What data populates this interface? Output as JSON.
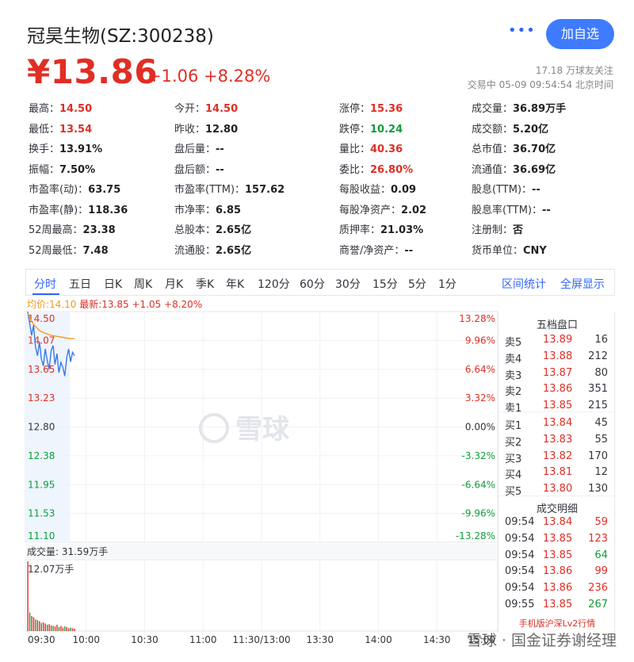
{
  "header": {
    "title": "冠昊生物(SZ:300238)",
    "more_icon": "more-dots-icon",
    "follow_label": "加自选",
    "price": "¥13.86",
    "change": "+1.06 +8.28%",
    "fans": "17.18 万球友关注",
    "status": "交易中 05-09 09:54:54 北京时间"
  },
  "quote": {
    "rows": [
      [
        {
          "label": "最高：",
          "value": "14.50",
          "color": "red"
        },
        {
          "label": "今开：",
          "value": "14.50",
          "color": "red"
        },
        {
          "label": "涨停：",
          "value": "15.36",
          "color": "red"
        },
        {
          "label": "成交量：",
          "value": "36.89万手",
          "color": ""
        }
      ],
      [
        {
          "label": "最低：",
          "value": "13.54",
          "color": "red"
        },
        {
          "label": "昨收：",
          "value": "12.80",
          "color": ""
        },
        {
          "label": "跌停：",
          "value": "10.24",
          "color": "green"
        },
        {
          "label": "成交额：",
          "value": "5.20亿",
          "color": ""
        }
      ],
      [
        {
          "label": "换手：",
          "value": "13.91%",
          "color": ""
        },
        {
          "label": "盘后量：",
          "value": "--",
          "color": ""
        },
        {
          "label": "量比：",
          "value": "40.36",
          "color": "red"
        },
        {
          "label": "总市值：",
          "value": "36.70亿",
          "color": ""
        }
      ],
      [
        {
          "label": "振幅：",
          "value": "7.50%",
          "color": ""
        },
        {
          "label": "盘后额：",
          "value": "--",
          "color": ""
        },
        {
          "label": "委比：",
          "value": "26.80%",
          "color": "red"
        },
        {
          "label": "流通值：",
          "value": "36.69亿",
          "color": ""
        }
      ],
      [
        {
          "label": "市盈率(动)：",
          "value": "63.75",
          "color": ""
        },
        {
          "label": "市盈率(TTM)：",
          "value": "157.62",
          "color": ""
        },
        {
          "label": "每股收益：",
          "value": "0.09",
          "color": ""
        },
        {
          "label": "股息(TTM)：",
          "value": "--",
          "color": ""
        }
      ],
      [
        {
          "label": "市盈率(静)：",
          "value": "118.36",
          "color": ""
        },
        {
          "label": "市净率：",
          "value": "6.85",
          "color": ""
        },
        {
          "label": "每股净资产：",
          "value": "2.02",
          "color": ""
        },
        {
          "label": "股息率(TTM)：",
          "value": "--",
          "color": ""
        }
      ],
      [
        {
          "label": "52周最高：",
          "value": "23.38",
          "color": ""
        },
        {
          "label": "总股本：",
          "value": "2.65亿",
          "color": ""
        },
        {
          "label": "质押率：",
          "value": "21.03%",
          "color": ""
        },
        {
          "label": "注册制：",
          "value": "否",
          "color": ""
        }
      ],
      [
        {
          "label": "52周最低：",
          "value": "7.48",
          "color": ""
        },
        {
          "label": "流通股：",
          "value": "2.65亿",
          "color": ""
        },
        {
          "label": "商誉/净资产：",
          "value": "--",
          "color": ""
        },
        {
          "label": "货币单位：",
          "value": "CNY",
          "color": ""
        }
      ]
    ]
  },
  "tabs": {
    "items": [
      "分时",
      "五日",
      "日K",
      "周K",
      "月K",
      "季K",
      "年K",
      "120分",
      "60分",
      "30分",
      "15分",
      "5分",
      "1分"
    ],
    "active": 0,
    "right": [
      "区间统计",
      "全屏显示"
    ]
  },
  "legend": {
    "avg": "均价:14.10",
    "last": "最新:13.85 +1.05 +8.20%"
  },
  "colors": {
    "up": "#e02e24",
    "down": "#0f9d3a",
    "price_line": "#3c78e8",
    "avg_line": "#f39a1d",
    "accent": "#3064ff"
  },
  "chart_data": {
    "type": "line",
    "price_labels": [
      "14.50",
      "14.07",
      "13.65",
      "13.23",
      "12.80",
      "12.38",
      "11.95",
      "11.53",
      "11.10"
    ],
    "pct_labels": [
      "13.28%",
      "9.96%",
      "6.64%",
      "3.32%",
      "0.00%",
      "-3.32%",
      "-6.64%",
      "-9.96%",
      "-13.28%"
    ],
    "ylim": [
      11.1,
      14.5
    ],
    "x_ticks": [
      "09:30",
      "10:00",
      "10:30",
      "11:00",
      "11:30/13:00",
      "13:30",
      "14:00",
      "14:30",
      "15:00"
    ],
    "series": [
      {
        "name": "价格",
        "x": [
          0,
          1,
          2,
          3,
          4,
          5,
          6,
          7,
          8,
          9,
          10,
          11,
          12,
          13,
          14,
          15,
          16,
          17,
          18,
          19,
          20,
          21,
          22,
          23,
          24
        ],
        "values": [
          14.5,
          14.32,
          14.15,
          14.3,
          13.98,
          13.85,
          14.05,
          13.8,
          13.7,
          13.95,
          13.78,
          13.65,
          13.92,
          14.0,
          13.72,
          13.88,
          13.6,
          13.75,
          13.68,
          13.55,
          13.82,
          13.95,
          13.76,
          13.9,
          13.85
        ]
      },
      {
        "name": "均价",
        "x": [
          0,
          2,
          4,
          6,
          8,
          10,
          12,
          14,
          16,
          18,
          20,
          22,
          24
        ],
        "values": [
          14.48,
          14.35,
          14.28,
          14.22,
          14.19,
          14.17,
          14.15,
          14.14,
          14.13,
          14.12,
          14.11,
          14.1,
          14.1
        ]
      }
    ],
    "volume_title": "成交量: 31.59万手",
    "volume_max_label": "12.07万手",
    "volume": [
      12.07,
      3.2,
      2.6,
      2.4,
      2.0,
      1.9,
      1.7,
      1.4,
      1.5,
      1.3,
      1.1,
      1.2,
      1.0,
      0.9,
      0.8,
      1.1,
      0.7,
      0.9,
      0.6,
      0.8,
      0.7,
      0.5,
      0.6,
      0.5,
      0.4
    ],
    "volume_ylim": [
      0,
      12.07
    ]
  },
  "order_book": {
    "title": "五档盘口",
    "asks": [
      {
        "label": "卖5",
        "price": "13.89",
        "vol": "16"
      },
      {
        "label": "卖4",
        "price": "13.88",
        "vol": "212"
      },
      {
        "label": "卖3",
        "price": "13.87",
        "vol": "80"
      },
      {
        "label": "卖2",
        "price": "13.86",
        "vol": "351"
      },
      {
        "label": "卖1",
        "price": "13.85",
        "vol": "215"
      }
    ],
    "bids": [
      {
        "label": "买1",
        "price": "13.84",
        "vol": "45"
      },
      {
        "label": "买2",
        "price": "13.83",
        "vol": "55"
      },
      {
        "label": "买3",
        "price": "13.82",
        "vol": "170"
      },
      {
        "label": "买4",
        "price": "13.81",
        "vol": "12"
      },
      {
        "label": "买5",
        "price": "13.80",
        "vol": "130"
      }
    ],
    "trades_title": "成交明细",
    "trades": [
      {
        "time": "09:54",
        "price": "13.84",
        "vol": "59",
        "dir": "red"
      },
      {
        "time": "09:54",
        "price": "13.85",
        "vol": "123",
        "dir": "red"
      },
      {
        "time": "09:54",
        "price": "13.85",
        "vol": "64",
        "dir": "green"
      },
      {
        "time": "09:54",
        "price": "13.86",
        "vol": "99",
        "dir": "red"
      },
      {
        "time": "09:54",
        "price": "13.86",
        "vol": "236",
        "dir": "red"
      },
      {
        "time": "09:55",
        "price": "13.85",
        "vol": "267",
        "dir": "green"
      }
    ],
    "lv2_link": "手机版沪深Lv2行情"
  },
  "watermark": {
    "chart_logo": "雪球",
    "footer": "雪球 · 国金证券谢经理"
  }
}
